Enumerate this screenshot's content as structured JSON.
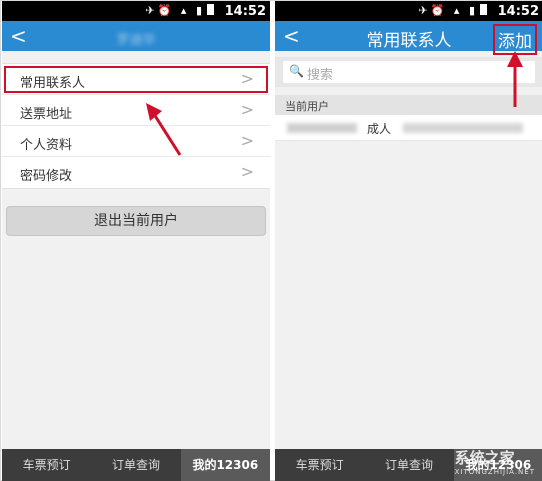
{
  "status": {
    "time": "14:52"
  },
  "left": {
    "back": "<",
    "title_blurred": "罗迪华",
    "menu": [
      {
        "label": "常用联系人",
        "chev": ">"
      },
      {
        "label": "送票地址",
        "chev": ">"
      },
      {
        "label": "个人资料",
        "chev": ">"
      },
      {
        "label": "密码修改",
        "chev": ">"
      }
    ],
    "logout": "退出当前用户"
  },
  "right": {
    "back": "<",
    "title": "常用联系人",
    "action": "添加",
    "search_placeholder": "搜索",
    "section_label": "当前用户",
    "contact_type": "成人"
  },
  "tabs": [
    {
      "label": "车票预订"
    },
    {
      "label": "订单查询"
    },
    {
      "label": "我的12306"
    }
  ],
  "watermark": {
    "main": "系统之家",
    "sub": "XITONGZHIJIA.NET"
  },
  "colors": {
    "appbar": "#2a8ad2",
    "highlight": "#d0102a",
    "tabbar": "#3c3c3c"
  }
}
